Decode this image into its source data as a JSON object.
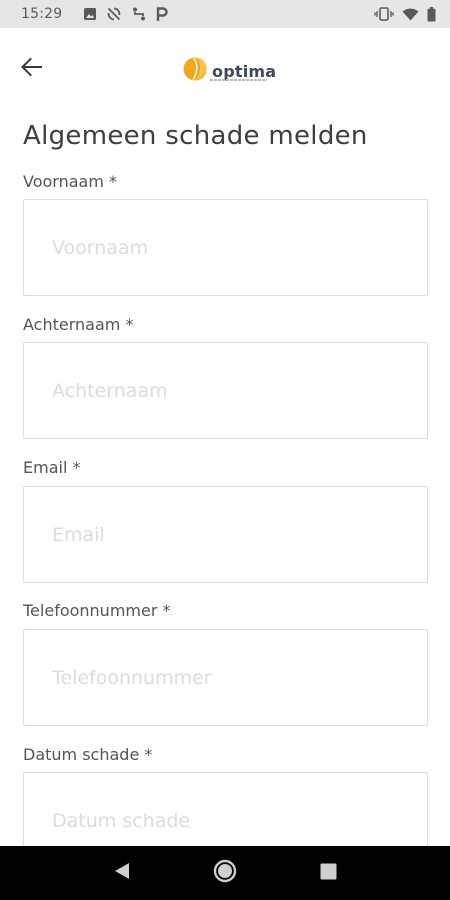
{
  "status_bar": {
    "time": "15:29",
    "left_icons": [
      "image-icon",
      "sync-off-icon",
      "route-icon",
      "parking-icon"
    ],
    "right_icons": [
      "vibrate-icon",
      "wifi-icon",
      "battery-icon"
    ]
  },
  "app_bar": {
    "back_icon": "arrow-back-icon",
    "logo_text": "optima",
    "colors": {
      "logo_orange": "#f2a81d",
      "logo_text": "#3f4a57"
    }
  },
  "form": {
    "title": "Algemeen schade melden",
    "fields": [
      {
        "label": "Voornaam *",
        "placeholder": "Voornaam",
        "value": ""
      },
      {
        "label": "Achternaam *",
        "placeholder": "Achternaam",
        "value": ""
      },
      {
        "label": "Email *",
        "placeholder": "Email",
        "value": ""
      },
      {
        "label": "Telefoonnummer *",
        "placeholder": "Telefoonnummer",
        "value": ""
      },
      {
        "label": "Datum schade *",
        "placeholder": "Datum schade",
        "value": ""
      }
    ]
  },
  "nav_bar": {
    "buttons": [
      "back-triangle-icon",
      "home-circle-icon",
      "recents-square-icon"
    ]
  }
}
